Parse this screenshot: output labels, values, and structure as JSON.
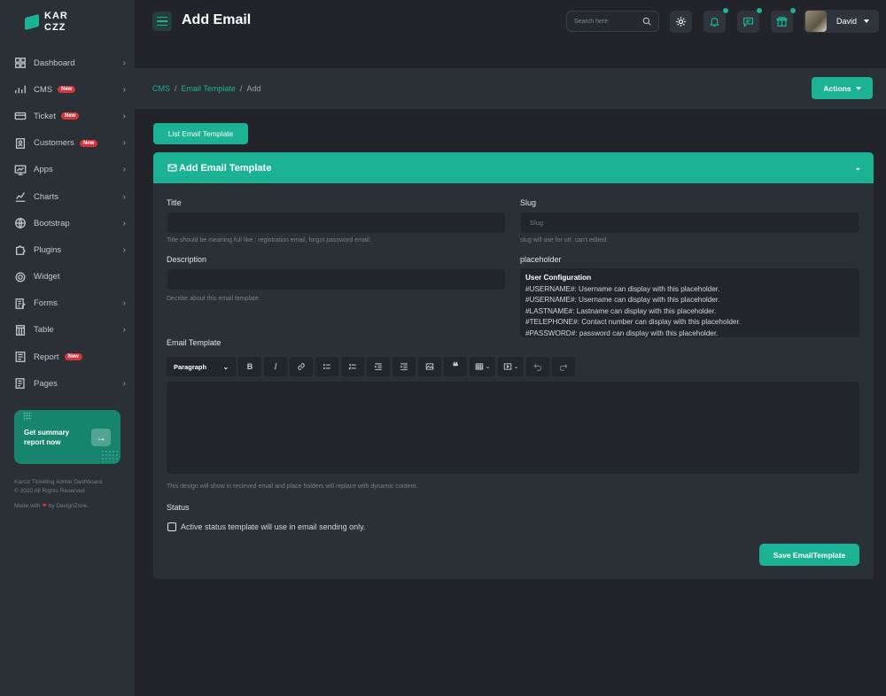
{
  "brand": {
    "logo_text": "KAR\nCZZ"
  },
  "sidebar": {
    "items": [
      {
        "label": "Dashboard",
        "icon": "dashboard-icon",
        "badge": "",
        "chevron": true
      },
      {
        "label": "CMS",
        "icon": "chart-bars-icon",
        "badge": "New",
        "chevron": true
      },
      {
        "label": "Ticket",
        "icon": "ticket-icon",
        "badge": "New",
        "chevron": true
      },
      {
        "label": "Customers",
        "icon": "customers-icon",
        "badge": "New",
        "chevron": true
      },
      {
        "label": "Apps",
        "icon": "apps-icon",
        "badge": "",
        "chevron": true
      },
      {
        "label": "Charts",
        "icon": "charts-icon",
        "badge": "",
        "chevron": true
      },
      {
        "label": "Bootstrap",
        "icon": "globe-icon",
        "badge": "",
        "chevron": true
      },
      {
        "label": "Plugins",
        "icon": "puzzle-icon",
        "badge": "",
        "chevron": true
      },
      {
        "label": "Widget",
        "icon": "widget-icon",
        "badge": "",
        "chevron": false
      },
      {
        "label": "Forms",
        "icon": "forms-icon",
        "badge": "",
        "chevron": true
      },
      {
        "label": "Table",
        "icon": "table-icon",
        "badge": "",
        "chevron": true
      },
      {
        "label": "Report",
        "icon": "report-icon",
        "badge": "New",
        "chevron": false
      },
      {
        "label": "Pages",
        "icon": "pages-icon",
        "badge": "",
        "chevron": true
      }
    ],
    "summary": {
      "text": "Get summary report now",
      "button_icon": "arrow-right-icon"
    },
    "footer": {
      "line1": "Karciz Ticketing Admin Dashboard",
      "line2": "© 2022 All Rights Reserved",
      "made_prefix": "Made with",
      "made_suffix": "by DexignZone"
    }
  },
  "header": {
    "title": "Add Email",
    "search_placeholder": "Search here",
    "user_name": "David"
  },
  "breadcrumb": {
    "items": [
      "CMS",
      "Email Template",
      "Add"
    ],
    "separator": "/"
  },
  "actions_label": "Actions",
  "list_button": "List Email Template",
  "card": {
    "title": "Add Email Template",
    "title_label": "Title",
    "title_value": "",
    "title_help": "Title should be meaning full like : registration email, forgot password email.",
    "slug_label": "Slug",
    "slug_placeholder": "Slug",
    "slug_help": "slug will use for url. can't edited.",
    "description_label": "Description",
    "description_value": "",
    "description_help": "Decribe about this email template.",
    "placeholder_label": "placeholder",
    "placeholder_box": {
      "heading": "User Configuration",
      "lines": [
        "#USERNAME#: Username can display with this placeholder.",
        "#USERNAME#: Username can display with this placeholder.",
        "#LASTNAME#: Lastname can display with this placeholder.",
        "#TELEPHONE#: Contact number can display with this placeholder.",
        "#PASSWORD#: password can display with this placeholder."
      ]
    },
    "email_template_label": "Email Template",
    "editor": {
      "format_select": "Paragraph",
      "content": ""
    },
    "editor_help": "This design will show in recieved email and place holders will replace with dynamic content.",
    "status_label": "Status",
    "status_checkbox_label": "Active status template will use in email sending only.",
    "status_checked": false,
    "save_label": "Save EmailTemplate"
  },
  "colors": {
    "accent": "#1bb394",
    "badge": "#d6343d",
    "background": "#222429",
    "panel": "#2b2f36"
  }
}
